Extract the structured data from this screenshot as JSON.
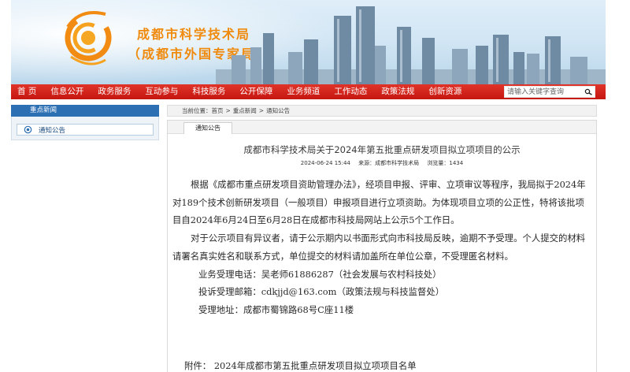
{
  "header": {
    "site_title": "成都市科学技术局",
    "site_subtitle": "（成都市外国专家局）",
    "logo": "sun-swirl-logo",
    "colors": {
      "title": "#f08a0c",
      "nav": "#d0201a",
      "accent": "#2d6fb3"
    }
  },
  "nav": {
    "items": [
      "首 页",
      "信息公开",
      "政务服务",
      "互动参与",
      "科技服务",
      "公开保障",
      "业务频道",
      "工作动态",
      "政策法规",
      "创新资源"
    ],
    "search_placeholder": "请输入关键字查询",
    "search_icon": "search-icon"
  },
  "sidebar": {
    "heading": "重点新闻",
    "items": [
      {
        "label": "通知公告",
        "icon": "circle-dot-icon"
      }
    ]
  },
  "breadcrumb": {
    "lead": "当前位置：",
    "items": [
      "首页",
      "重点新闻",
      "通知公告"
    ],
    "separator": ">"
  },
  "article": {
    "tab_label": "通知公告",
    "title": "成都市科学技术局关于2024年第五批重点研发项目拟立项项目的公示",
    "meta": {
      "date": "2024-06-24 15:44",
      "source": "来源：成都市科学技术局",
      "views": "浏览量：1434"
    },
    "paragraphs": [
      "根据《成都市重点研发项目资助管理办法》，经项目申报、评审、立项审议等程序，我局拟于2024年对189个技术创新研发项目（一般项目）申报项目进行立项资助。为体现项目立项的公正性，特将该批项目自2024年6月24日至6月28日在成都市科技局网站上公示5个工作日。",
      "对于公示项目有异议者，请于公示期内以书面形式向市科技局反映，逾期不予受理。个人提交的材料请署名真实姓名和联系方式，单位提交的材料请加盖所在单位公章，不受理匿名材料。"
    ],
    "contacts": [
      "业务受理电话：吴老师61886287（社会发展与农村科技处）",
      "投诉受理邮箱：cdkjjd@163.com（政策法规与科技监督处）",
      "受理地址：成都市蜀锦路68号C座11楼"
    ],
    "attachment_label": "附件：",
    "attachment_name": "2024年成都市第五批重点研发项目拟立项项目名单"
  }
}
